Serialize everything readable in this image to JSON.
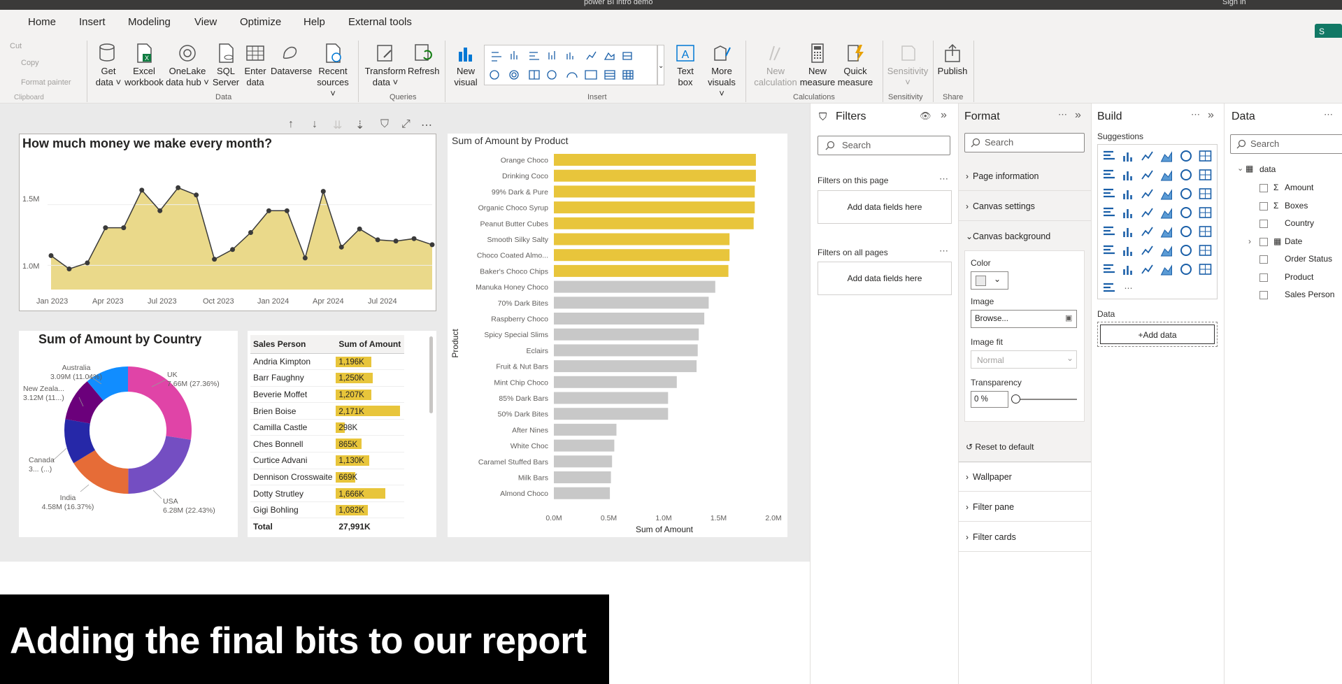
{
  "titlebar": {
    "title": "power BI intro demo",
    "signin": "Sign in"
  },
  "ribbon_tabs": [
    "Home",
    "Insert",
    "Modeling",
    "View",
    "Optimize",
    "Help",
    "External tools"
  ],
  "share_label": "S",
  "ribbon": {
    "clipboard": {
      "cut": "Cut",
      "copy": "Copy",
      "format_painter": "Format painter",
      "group": "Clipboard"
    },
    "data_group": "Data",
    "get_data": [
      "Get",
      "data ˅"
    ],
    "excel": [
      "Excel",
      "workbook"
    ],
    "onelake": [
      "OneLake",
      "data hub ˅"
    ],
    "sql": [
      "SQL",
      "Server"
    ],
    "enter_data": [
      "Enter",
      "data"
    ],
    "dataverse": [
      "Dataverse",
      ""
    ],
    "recent": [
      "Recent",
      "sources ˅"
    ],
    "queries_group": "Queries",
    "transform": [
      "Transform",
      "data ˅"
    ],
    "refresh": [
      "Refresh",
      ""
    ],
    "insert_group": "Insert",
    "new_visual": [
      "New",
      "visual"
    ],
    "text_box": [
      "Text",
      "box"
    ],
    "more_visuals": [
      "More",
      "visuals ˅"
    ],
    "calc_group": "Calculations",
    "new_calc": [
      "New",
      "calculation"
    ],
    "new_measure": [
      "New",
      "measure"
    ],
    "quick_measure": [
      "Quick",
      "measure"
    ],
    "sens_group": "Sensitivity",
    "sensitivity": [
      "Sensitivity",
      "˅"
    ],
    "share_group": "Share",
    "publish": [
      "Publish",
      ""
    ]
  },
  "line_chart": {
    "title": "How much money we make every month?",
    "y_ticks": [
      "1.5M",
      "1.0M"
    ],
    "x_ticks": [
      "Jan 2023",
      "Apr 2023",
      "Jul 2023",
      "Oct 2023",
      "Jan 2024",
      "Apr 2024",
      "Jul 2024"
    ]
  },
  "bar_chart": {
    "title": "Sum of Amount by Product",
    "xlabel": "Sum of Amount",
    "ylabel": "Product"
  },
  "donut_chart": {
    "title": "Sum of Amount by Country"
  },
  "table": {
    "headers": [
      "Sales Person",
      "Sum of Amount"
    ],
    "rows": [
      {
        "name": "Andria Kimpton",
        "amount": "1,196K",
        "value": 1196
      },
      {
        "name": "Barr Faughny",
        "amount": "1,250K",
        "value": 1250
      },
      {
        "name": "Beverie Moffet",
        "amount": "1,207K",
        "value": 1207
      },
      {
        "name": "Brien Boise",
        "amount": "2,171K",
        "value": 2171
      },
      {
        "name": "Camilla Castle",
        "amount": "298K",
        "value": 298
      },
      {
        "name": "Ches Bonnell",
        "amount": "865K",
        "value": 865
      },
      {
        "name": "Curtice Advani",
        "amount": "1,130K",
        "value": 1130
      },
      {
        "name": "Dennison Crosswaite",
        "amount": "669K",
        "value": 669
      },
      {
        "name": "Dotty Strutley",
        "amount": "1,666K",
        "value": 1666
      },
      {
        "name": "Gigi Bohling",
        "amount": "1,082K",
        "value": 1082
      }
    ],
    "total_label": "Total",
    "total_value": "27,991K"
  },
  "caption": "Adding the final bits to our report",
  "filters": {
    "title": "Filters",
    "search": "Search",
    "on_page": "Filters on this page",
    "on_all": "Filters on all pages",
    "add_fields": "Add data fields here"
  },
  "format": {
    "title": "Format",
    "search": "Search",
    "sections": [
      "Page information",
      "Canvas settings",
      "Canvas background"
    ],
    "color_label": "Color",
    "image_label": "Image",
    "browse": "Browse...",
    "image_fit_label": "Image fit",
    "image_fit_value": "Normal",
    "transparency_label": "Transparency",
    "transparency_value": "0 %",
    "reset": "Reset to default",
    "more_sections": [
      "Wallpaper",
      "Filter pane",
      "Filter cards"
    ]
  },
  "build": {
    "title": "Build",
    "suggestions": "Suggestions",
    "data_label": "Data",
    "add_data": "+Add data"
  },
  "data_pane": {
    "title": "Data",
    "search": "Search",
    "table_name": "data",
    "fields": [
      "Amount",
      "Boxes",
      "Country",
      "Date",
      "Order Status",
      "Product",
      "Sales Person"
    ]
  },
  "chart_data": [
    {
      "type": "area",
      "title": "How much money we make every month?",
      "x": [
        "Jan 2023",
        "Feb 2023",
        "Mar 2023",
        "Apr 2023",
        "May 2023",
        "Jun 2023",
        "Jul 2023",
        "Aug 2023",
        "Sep 2023",
        "Oct 2023",
        "Nov 2023",
        "Dec 2023",
        "Jan 2024",
        "Feb 2024",
        "Mar 2024",
        "Apr 2024",
        "May 2024",
        "Jun 2024",
        "Jul 2024",
        "Aug 2024",
        "Sep 2024"
      ],
      "values": [
        1.08,
        0.97,
        1.02,
        1.31,
        1.31,
        1.62,
        1.45,
        1.64,
        1.58,
        1.05,
        1.13,
        1.27,
        1.45,
        1.45,
        1.06,
        1.61,
        1.15,
        1.3,
        1.21,
        1.2,
        1.22,
        1.17
      ],
      "ylim": [
        0.8,
        1.85
      ]
    },
    {
      "type": "bar",
      "title": "Sum of Amount by Product",
      "xlabel": "Sum of Amount",
      "ylabel": "Product",
      "categories": [
        "Orange Choco",
        "Drinking Coco",
        "99% Dark & Pure",
        "Organic Choco Syrup",
        "Peanut Butter Cubes",
        "Smooth Silky Salty",
        "Choco Coated Almo...",
        "Baker's Choco Chips",
        "Manuka Honey Choco",
        "70% Dark Bites",
        "Raspberry Choco",
        "Spicy Special Slims",
        "Eclairs",
        "Fruit & Nut Bars",
        "Mint Chip Choco",
        "85% Dark Bars",
        "50% Dark Bites",
        "After Nines",
        "White Choc",
        "Caramel Stuffed Bars",
        "Milk Bars",
        "Almond Choco"
      ],
      "values": [
        1.84,
        1.84,
        1.83,
        1.83,
        1.82,
        1.6,
        1.6,
        1.59,
        1.47,
        1.41,
        1.37,
        1.32,
        1.31,
        1.3,
        1.12,
        1.04,
        1.04,
        0.57,
        0.55,
        0.53,
        0.52,
        0.51
      ],
      "highlighted_count": 8,
      "highlight_color": "#e8c53b",
      "base_color": "#c8c8c8",
      "x_ticks": [
        "0.0M",
        "0.5M",
        "1.0M",
        "1.5M",
        "2.0M"
      ],
      "xlim": [
        0,
        2.0
      ]
    },
    {
      "type": "pie",
      "title": "Sum of Amount by Country",
      "categories": [
        "UK",
        "USA",
        "India",
        "Canada",
        "New Zealand",
        "Australia"
      ],
      "values": [
        7.66,
        6.28,
        4.58,
        3.2,
        3.12,
        3.09
      ],
      "labels": [
        "UK\n7.66M (27.36%)",
        "USA\n6.28M (22.43%)",
        "India\n4.58M (16.37%)",
        "Canada\n3... (...)",
        "New Zeala...\n3.12M (11...)",
        "Australia\n3.09M (11.04%)"
      ],
      "colors": [
        "#e044a7",
        "#744ec2",
        "#e66c37",
        "#2628a8",
        "#6b007b",
        "#118dff"
      ]
    }
  ]
}
